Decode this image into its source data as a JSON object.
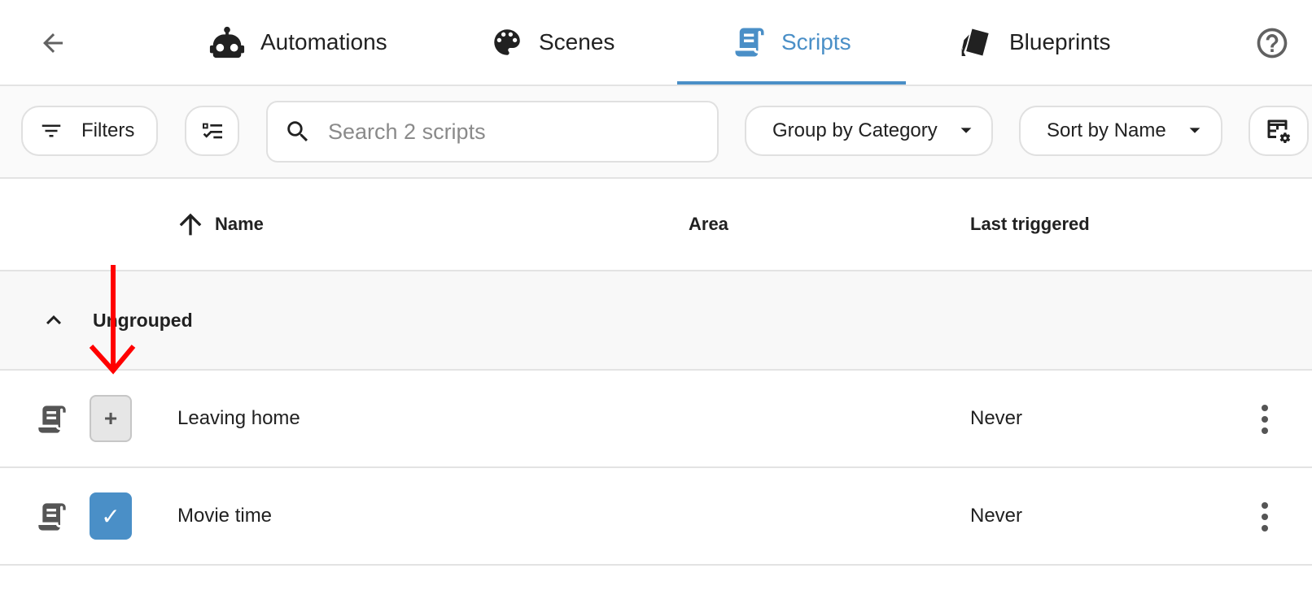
{
  "nav": {
    "tabs": [
      {
        "label": "Automations",
        "icon": "robot-icon"
      },
      {
        "label": "Scenes",
        "icon": "palette-icon"
      },
      {
        "label": "Scripts",
        "icon": "script-icon",
        "active": true
      },
      {
        "label": "Blueprints",
        "icon": "blueprint-icon"
      }
    ],
    "active_color": "#4a8fc7"
  },
  "toolbar": {
    "filters_label": "Filters",
    "search_placeholder": "Search 2 scripts",
    "group_by_label": "Group by Category",
    "sort_by_label": "Sort by Name"
  },
  "table": {
    "columns": [
      "Name",
      "Area",
      "Last triggered"
    ],
    "group_label": "Ungrouped",
    "rows": [
      {
        "name": "Leaving home",
        "area": "",
        "last_triggered": "Never",
        "selected": false
      },
      {
        "name": "Movie time",
        "area": "",
        "last_triggered": "Never",
        "selected": true
      }
    ]
  },
  "annotation": {
    "color": "#ff0000"
  }
}
